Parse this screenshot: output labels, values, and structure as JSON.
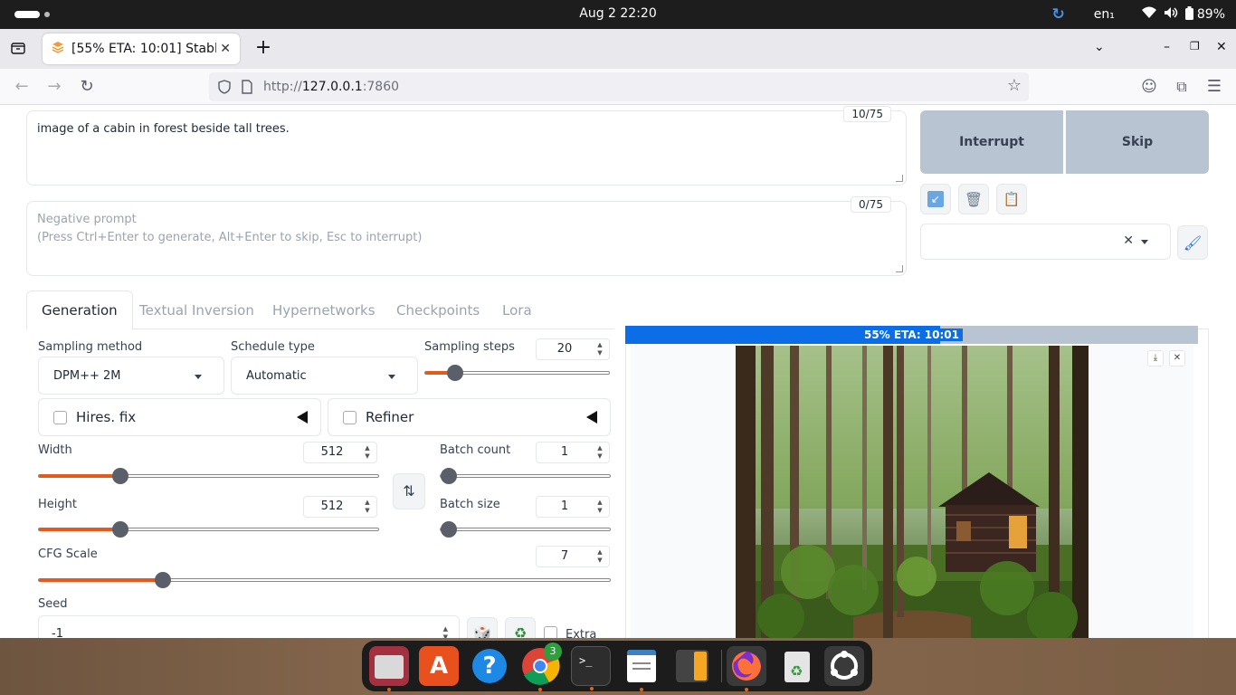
{
  "system": {
    "clock": "Aug 2  22:20",
    "lang": "en₁",
    "battery": "89%"
  },
  "browser": {
    "tab_title": "[55% ETA: 10:01] Stable D",
    "url_scheme": "http://",
    "url_host": "127.0.0.1",
    "url_port": ":7860"
  },
  "prompt": {
    "text": "image of a cabin in forest beside tall trees.",
    "counter": "10/75"
  },
  "negative_prompt": {
    "placeholder_line1": "Negative prompt",
    "placeholder_line2": "(Press Ctrl+Enter to generate, Alt+Enter to skip, Esc to interrupt)",
    "counter": "0/75"
  },
  "actions": {
    "interrupt": "Interrupt",
    "skip": "Skip"
  },
  "tabs": [
    "Generation",
    "Textual Inversion",
    "Hypernetworks",
    "Checkpoints",
    "Lora"
  ],
  "generation": {
    "sampling_method_label": "Sampling method",
    "sampling_method": "DPM++ 2M",
    "schedule_type_label": "Schedule type",
    "schedule_type": "Automatic",
    "sampling_steps_label": "Sampling steps",
    "sampling_steps": "20",
    "hires_fix": "Hires. fix",
    "refiner": "Refiner",
    "width_label": "Width",
    "width": "512",
    "height_label": "Height",
    "height": "512",
    "batch_count_label": "Batch count",
    "batch_count": "1",
    "batch_size_label": "Batch size",
    "batch_size": "1",
    "cfg_label": "CFG Scale",
    "cfg": "7",
    "seed_label": "Seed",
    "seed": "-1",
    "extra": "Extra"
  },
  "progress": {
    "text": "55% ETA: 10:01",
    "fraction": 0.55
  },
  "dock": {
    "chrome_badge": "3"
  },
  "colors": {
    "accent": "#e35a1e",
    "progress": "#0b6ee6",
    "button_bg": "#b8c4d1"
  }
}
